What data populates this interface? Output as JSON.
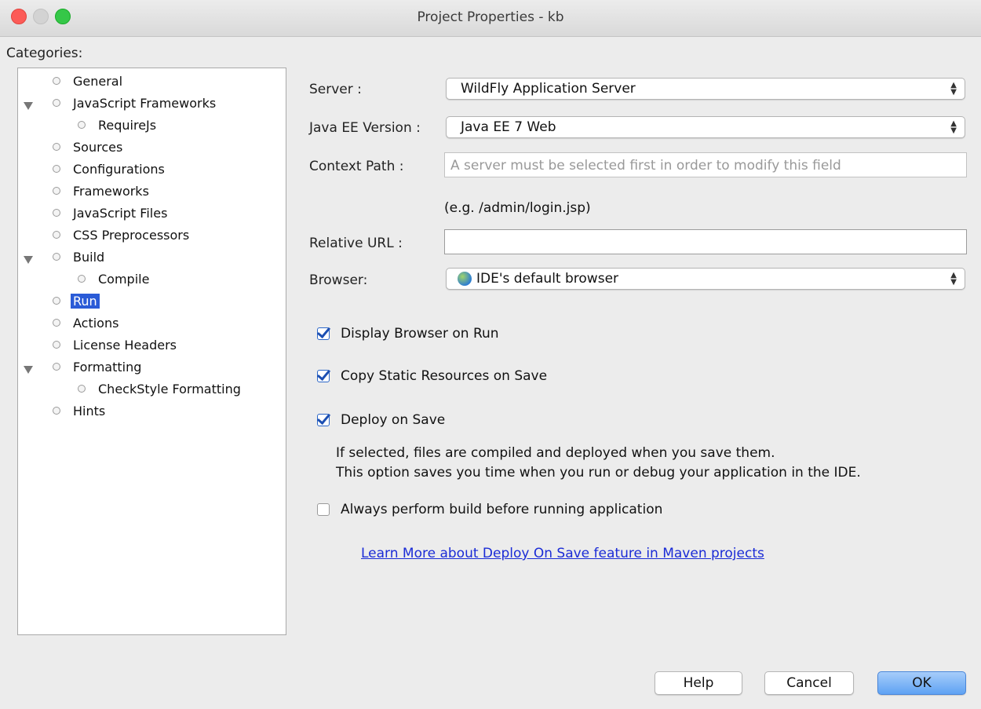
{
  "window": {
    "title": "Project Properties - kb"
  },
  "categories": {
    "label": "Categories:",
    "items": [
      {
        "label": "General"
      },
      {
        "label": "JavaScript Frameworks",
        "expanded": true
      },
      {
        "label": "RequireJs"
      },
      {
        "label": "Sources"
      },
      {
        "label": "Configurations"
      },
      {
        "label": "Frameworks"
      },
      {
        "label": "JavaScript Files"
      },
      {
        "label": "CSS Preprocessors"
      },
      {
        "label": "Build",
        "expanded": true
      },
      {
        "label": "Compile"
      },
      {
        "label": "Run",
        "selected": true
      },
      {
        "label": "Actions"
      },
      {
        "label": "License Headers"
      },
      {
        "label": "Formatting",
        "expanded": true
      },
      {
        "label": "CheckStyle Formatting"
      },
      {
        "label": "Hints"
      }
    ]
  },
  "form": {
    "server_label": "Server :",
    "server_value": "WildFly Application Server",
    "javaee_label": "Java EE Version :",
    "javaee_value": "Java EE 7 Web",
    "context_label": "Context Path :",
    "context_placeholder": "A server must be selected first in order to modify this field",
    "example_hint": "(e.g. /admin/login.jsp)",
    "relurl_label": "Relative URL :",
    "relurl_value": "",
    "browser_label": "Browser:",
    "browser_value": "IDE's default browser",
    "browser_icon": "globe-icon"
  },
  "options": {
    "display_browser": {
      "label": "Display Browser on Run",
      "checked": true
    },
    "copy_static": {
      "label": "Copy Static Resources on Save",
      "checked": true
    },
    "deploy_on_save": {
      "label": "Deploy on Save",
      "checked": true
    },
    "deploy_note_line1": "If selected, files are compiled and deployed when you save them.",
    "deploy_note_line2": "This option saves you time when you run or debug your application in the IDE.",
    "always_build": {
      "label": "Always perform build before running application",
      "checked": false
    }
  },
  "learn_more_link": "Learn More about Deploy On Save feature in Maven projects",
  "buttons": {
    "help": "Help",
    "cancel": "Cancel",
    "ok": "OK"
  },
  "colors": {
    "selection": "#2a5bd7",
    "link": "#1a2bd6",
    "ok_button": "#5ea2f3"
  }
}
